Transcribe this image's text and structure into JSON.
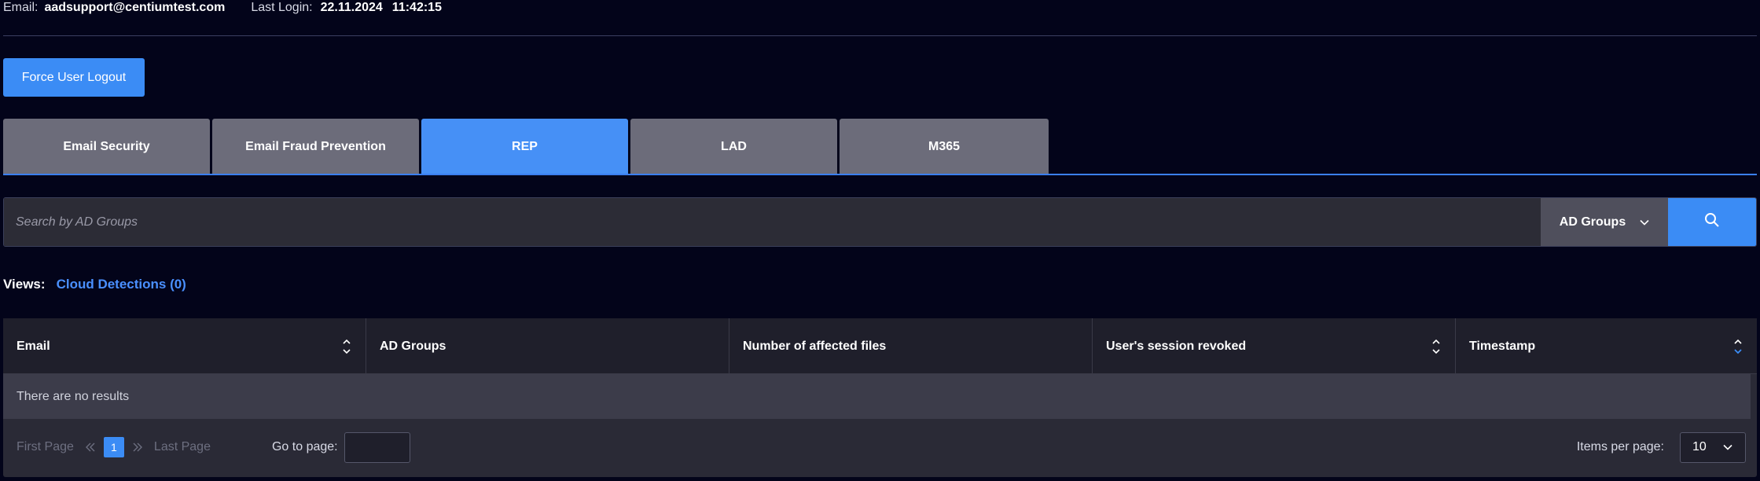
{
  "header": {
    "email_label": "Email:",
    "email_value": "aadsupport@centiumtest.com",
    "last_login_label": "Last Login:",
    "last_login_date": "22.11.2024",
    "last_login_time": "11:42:15"
  },
  "force_logout_label": "Force User Logout",
  "tabs": [
    {
      "label": "Email Security",
      "active": false
    },
    {
      "label": "Email Fraud Prevention",
      "active": false
    },
    {
      "label": "REP",
      "active": true
    },
    {
      "label": "LAD",
      "active": false
    },
    {
      "label": "M365",
      "active": false
    }
  ],
  "search": {
    "placeholder": "Search by AD Groups",
    "filter_value": "AD Groups"
  },
  "views": {
    "label": "Views:",
    "link": "Cloud Detections (0)"
  },
  "table": {
    "columns": [
      {
        "label": "Email",
        "sortable": true
      },
      {
        "label": "AD Groups",
        "sortable": false
      },
      {
        "label": "Number of affected files",
        "sortable": false
      },
      {
        "label": "User's session revoked",
        "sortable": true
      },
      {
        "label": "Timestamp",
        "sortable": true,
        "sort_direction": "desc"
      }
    ],
    "empty_message": "There are no results"
  },
  "pagination": {
    "first_page": "First Page",
    "current_page": "1",
    "last_page": "Last Page",
    "go_to_label": "Go to page:",
    "go_to_value": "",
    "items_per_page_label": "Items per page:",
    "items_per_page_value": "10"
  },
  "colors": {
    "background": "#03041a",
    "accent": "#3b8cf5",
    "tab_inactive": "#6c6c7a",
    "link": "#4a90ff"
  }
}
